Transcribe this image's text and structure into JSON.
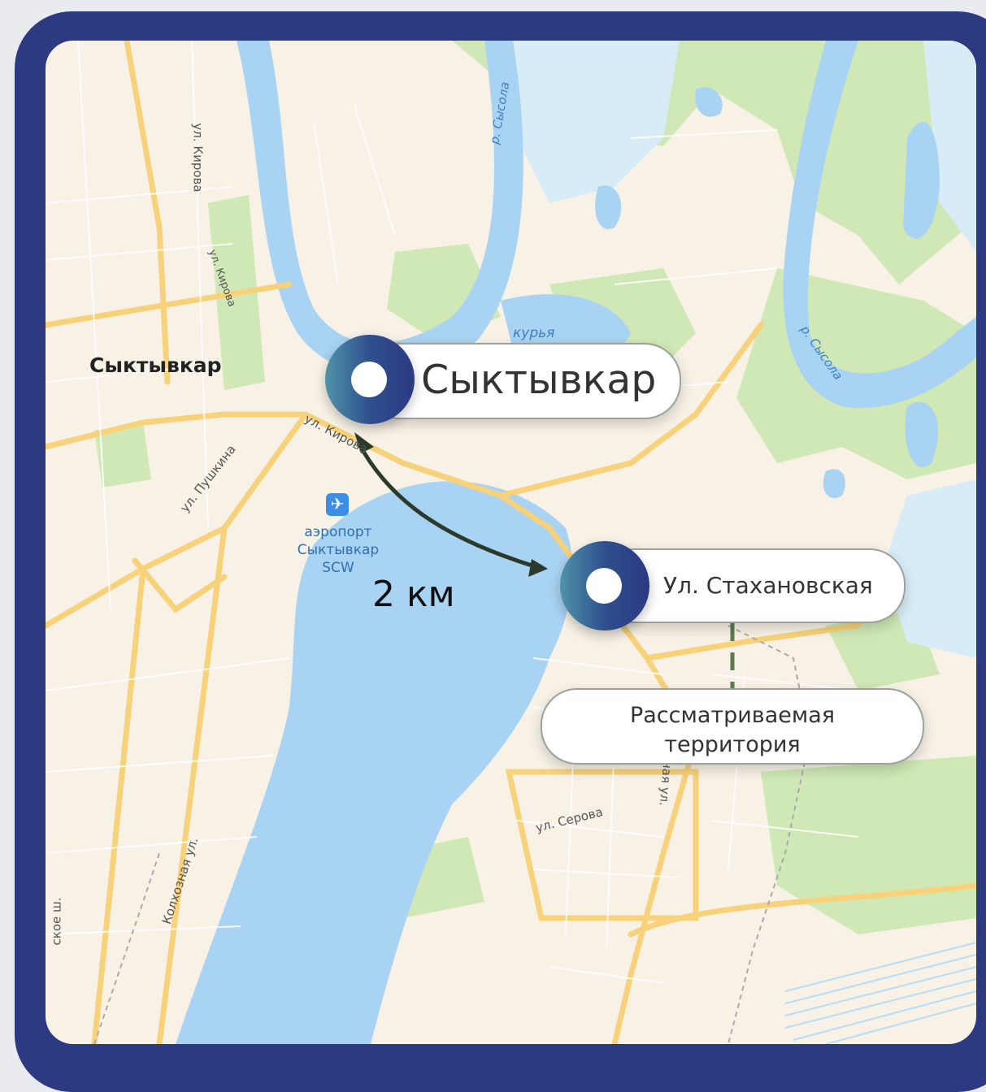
{
  "map": {
    "city_label": "Сыктывкар",
    "water_labels": {
      "river_sysola_top": "р. Сысола",
      "river_sysola_right": "р. Сысола",
      "kurya": "курья"
    },
    "streets": {
      "kirova_1": "ул. Кирова",
      "kirova_2": "ул. Кирова",
      "kirova_3": "ул. Кирова",
      "pushkina": "ул. Пушкина",
      "serova": "ул. Серова",
      "kolkhoznaya": "Колхозная ул.",
      "shosse": "ское ш.",
      "naya": "ная ул."
    },
    "airport": {
      "line1": "аэропорт",
      "line2": "Сыктывкар",
      "line3": "SCW",
      "icon": "airplane-icon"
    },
    "colors": {
      "frame": "#2c3a82",
      "water": "#a9d3f2",
      "park": "#cfe8b5",
      "road": "#f7d27a"
    }
  },
  "callouts": {
    "city": "Сыктывкар",
    "street": "Ул. Стахановская",
    "territory_line1": "Рассматриваемая",
    "territory_line2": "территория"
  },
  "distance": "2 км"
}
